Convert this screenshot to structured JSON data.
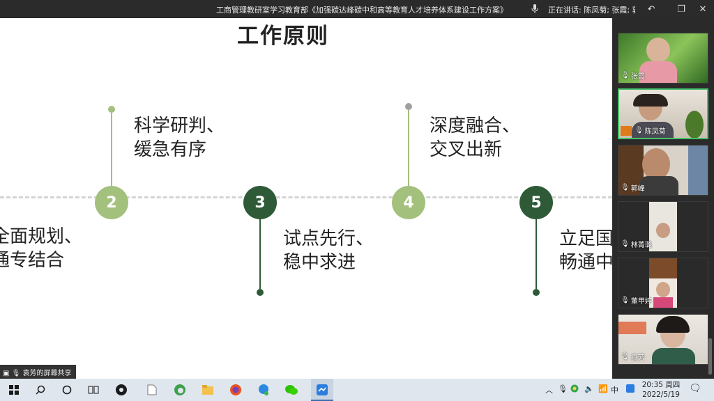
{
  "titlebar": {
    "doc_title": "工商管理教研室学习教育部《加强碳达峰碳中和高等教育人才培养体系建设工作方案》",
    "speaking_label": "正在讲话: 陈凤菊; 张霞; 郭..."
  },
  "slide": {
    "title": "工作原则",
    "nodes": [
      {
        "number": "2",
        "text_line1": "科学研判、",
        "text_line2": "缓急有序"
      },
      {
        "number": "3",
        "text_line1": "试点先行、",
        "text_line2": "稳中求进"
      },
      {
        "number": "4",
        "text_line1": "深度融合、",
        "text_line2": "交叉出新"
      },
      {
        "number": "5",
        "text_line1": "立足国",
        "text_line2": "畅通中"
      }
    ],
    "left_partial": {
      "text_line1": "全面规划、",
      "text_line2": "通专结合"
    },
    "colors": {
      "light_green": "#a3c07c",
      "dark_green": "#2e5a37",
      "dash": "#d4d4d4"
    }
  },
  "share_label": "袁芳的屏幕共享",
  "participants": [
    {
      "name": "张霞",
      "host": false,
      "active": false
    },
    {
      "name": "陈凤菊",
      "host": true,
      "active": true
    },
    {
      "name": "郭峰",
      "host": false,
      "active": false
    },
    {
      "name": "林菁璐",
      "host": false,
      "active": false
    },
    {
      "name": "董甲婷",
      "host": false,
      "active": false
    },
    {
      "name": "袁芳",
      "host": false,
      "active": false
    }
  ],
  "taskbar": {
    "time": "20:35 周四",
    "date": "2022/5/19",
    "ime": "中",
    "icons": [
      "windows-icon",
      "search-icon",
      "cortana-icon",
      "task-view-icon",
      "app-icon",
      "file-icon",
      "edge-icon",
      "explorer-icon",
      "firefox-icon",
      "chat-icon",
      "wechat-icon",
      "meeting-icon"
    ]
  }
}
